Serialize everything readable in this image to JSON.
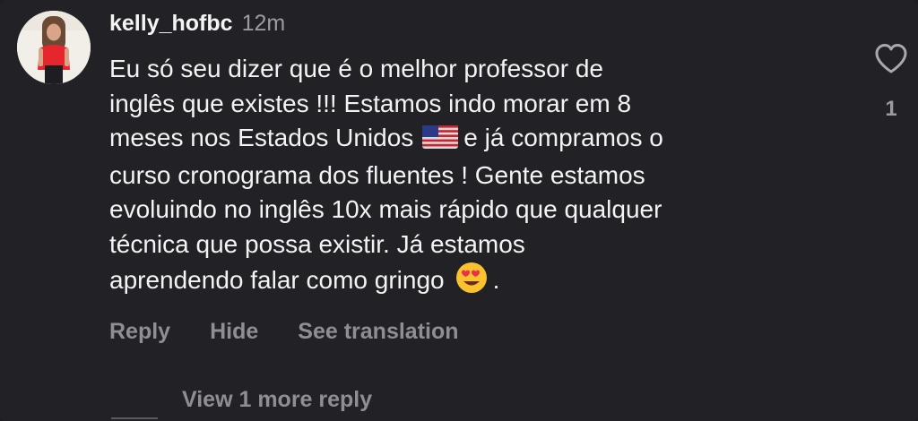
{
  "comment": {
    "username": "kelly_hofbc",
    "timestamp": "12m",
    "avatar_icon": "profile-photo",
    "lines": [
      {
        "text": "Eu só seu dizer que é o melhor professor de"
      },
      {
        "text": "inglês que existes !!! Estamos indo morar em 8"
      },
      {
        "before": "meses nos Estados Unidos",
        "emoji": "us-flag",
        "after": "e já compramos o"
      },
      {
        "text": "curso cronograma  dos fluentes ! Gente estamos"
      },
      {
        "text": "evoluindo no inglês 10x mais rápido que qualquer"
      },
      {
        "text": "técnica que possa existir. Já estamos"
      },
      {
        "before": "aprendendo falar como gringo",
        "emoji": "heart-eyes",
        "after": "."
      }
    ],
    "like_count": "1",
    "like_icon": "heart-outline-icon"
  },
  "actions": {
    "reply": "Reply",
    "hide": "Hide",
    "see_translation": "See translation"
  },
  "replies": {
    "view_more": "View 1 more reply"
  },
  "colors": {
    "background": "#222226",
    "text_primary": "#f3f3f3",
    "text_secondary": "#8e8e93"
  }
}
